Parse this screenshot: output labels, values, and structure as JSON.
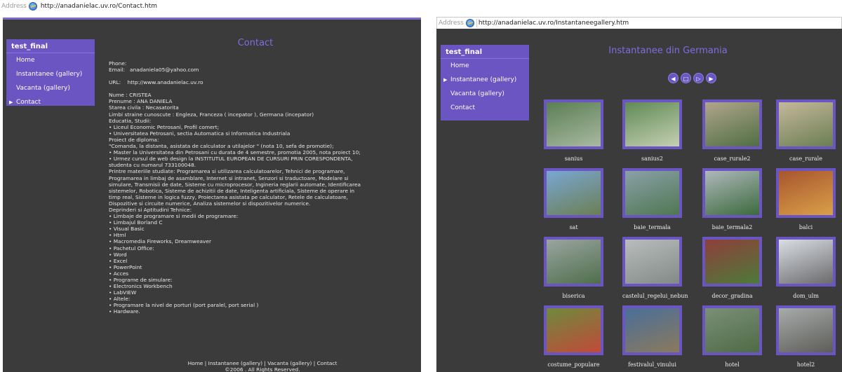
{
  "contact_window": {
    "address_label": "Address",
    "url": "http://anadanielac.uv.ro/Contact.htm",
    "brand": "test_final",
    "nav": [
      {
        "label": "Home"
      },
      {
        "label": "Instantanee (gallery)"
      },
      {
        "label": "Vacanta (gallery)"
      },
      {
        "label": "Contact",
        "active": true
      }
    ],
    "title": "Contact",
    "lines": [
      "Phone:",
      "Email:   anadaniela05@yahoo.com",
      "",
      "URL:    http://www.anadanielac.uv.ro",
      "",
      "Nume : CRISTEA",
      "Prenume : ANA DANIELA",
      "Starea civila : Necasatorita",
      "Limbi straine cunoscute : Engleza, Franceza ( incepator ), Germana (incepator)",
      "Educatia, Studii:",
      "• Liceul Economic Petrosani, Profil comert;",
      "• Universitatea Petrosani, sectia Automatica si Informatica Industriala",
      "Proiect de diploma:",
      "\"Comanda, la distanta, asistata de calculator a utilajelor \" (nota 10, sefa de promotie);",
      "• Master la Universitatea din Petrosani cu durata de 4 semestre, promotia 2005, nota proiect 10;",
      "• Urmez cursul de web design la INSTITUTUL EUROPEAN DE CURSURI PRIN CORESPONDENTA,",
      "studenta cu numarul 733100048.",
      "Printre materiile studiate: Programarea si utilizarea calculatoarelor, Tehnici de programare,",
      "Programarea in limbaj de asamblare, Internet si intranet, Senzori si traductoare, Modelare si",
      "simulare, Transmisii de date, Sisteme cu microprocesor, Ingineria reglarii automate, Identificarea",
      "sistemelor, Robotica, Sisteme de achizitii de date, Inteligenta artificiala, Sisteme de operare in",
      "timp real, Sisteme in logica fuzzy, Proiectarea asistata pe calculator, Retele de calculatoare,",
      "Dispozitive si circuite numerice, Analiza sistemelor si dispozitivelor numerice.",
      "Deprinderi si Aptitudini Tehnice:",
      "• Limbaje de programare si medii de programare:",
      "• Limbajul Borland C",
      "• Visual Basic",
      "• Html",
      "• Macromedia Fireworks, Dreamweaver",
      "• Pachetul Office:",
      "• Word",
      "• Excel",
      "• PowerPoint",
      "• Acces",
      "• Programe de simulare:",
      "• Electronics Workbench",
      "• LabVIEW",
      "• Altele:",
      "• Programare la nivel de porturi (port paralel, port serial )",
      "• Hardware."
    ],
    "footer_links": [
      "Home",
      "Instantanee (gallery)",
      "Vacanta (gallery)",
      "Contact"
    ],
    "footer_sep": " | ",
    "copyright": "©2006 . All Rights Reserved."
  },
  "gallery_window": {
    "address_label": "Address",
    "url": "http://anadanielac.uv.ro/Instantaneegallery.htm",
    "brand": "test_final",
    "nav": [
      {
        "label": "Home"
      },
      {
        "label": "Instantanee (gallery)",
        "active": true
      },
      {
        "label": "Vacanta (gallery)"
      },
      {
        "label": "Contact"
      }
    ],
    "title": "Instantanee din Germania",
    "controls": [
      {
        "icon": "previous-icon",
        "glyph": "◀"
      },
      {
        "icon": "index-icon",
        "glyph": "□"
      },
      {
        "icon": "play-icon",
        "glyph": "▷"
      },
      {
        "icon": "next-icon",
        "glyph": "▶"
      }
    ],
    "thumbnails": [
      {
        "caption": "sanius",
        "colors": [
          "#5a7f54",
          "#a9b9a0"
        ]
      },
      {
        "caption": "sanius2",
        "colors": [
          "#5f8a55",
          "#c5d0b3"
        ]
      },
      {
        "caption": "case_rurale2",
        "colors": [
          "#b0a58c",
          "#4f6e43"
        ]
      },
      {
        "caption": "case_rurale",
        "colors": [
          "#c5b89b",
          "#6a7e52"
        ]
      },
      {
        "caption": "sat",
        "colors": [
          "#7aa6d4",
          "#6b7f52"
        ]
      },
      {
        "caption": "baie_termala",
        "colors": [
          "#8aa0a7",
          "#4f7752"
        ]
      },
      {
        "caption": "baie_termala2",
        "colors": [
          "#aeb8bb",
          "#3c6a3c"
        ]
      },
      {
        "caption": "balci",
        "colors": [
          "#a8552e",
          "#d9a049"
        ]
      },
      {
        "caption": "biserica",
        "colors": [
          "#9aa5a0",
          "#4f6e4c"
        ]
      },
      {
        "caption": "castelul_regelui_nebun",
        "colors": [
          "#b9bdbd",
          "#828a87"
        ]
      },
      {
        "caption": "decor_gradina",
        "colors": [
          "#8e3f3a",
          "#4d7a3a"
        ]
      },
      {
        "caption": "dom_ulm",
        "colors": [
          "#d9dee3",
          "#6b6a6c"
        ]
      },
      {
        "caption": "costume_populare",
        "colors": [
          "#6e8a3c",
          "#c14a3a"
        ]
      },
      {
        "caption": "festivalul_vinului",
        "colors": [
          "#4a6e9a",
          "#8a7a5c"
        ]
      },
      {
        "caption": "hotel",
        "colors": [
          "#7b8f78",
          "#4f6b45"
        ]
      },
      {
        "caption": "hotel2",
        "colors": [
          "#a7abab",
          "#5d5d58"
        ]
      }
    ]
  }
}
